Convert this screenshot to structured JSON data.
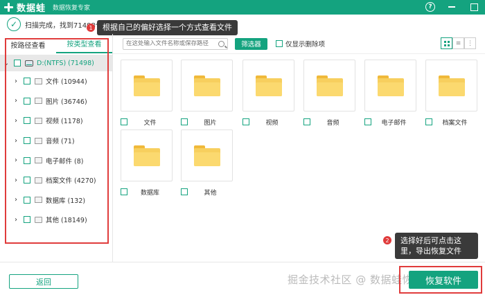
{
  "titlebar": {
    "app_name": "数据蛙",
    "app_subtitle": "数据恢复专家",
    "help_label": "?"
  },
  "scan": {
    "status_text": "扫描完成，找到71498个",
    "check_label": "✓"
  },
  "tooltips": {
    "tip1": "根据自己的偏好选择一个方式查看文件",
    "tip1_badge": "1",
    "tip2": "选择好后可点击这里，导出恢复文件",
    "tip2_badge": "2"
  },
  "left_panel": {
    "tabs": [
      {
        "label": "按路径查看"
      },
      {
        "label": "按类型查看"
      }
    ],
    "root": {
      "label": "D:(NTFS) (71498)"
    },
    "items": [
      {
        "label": "文件 (10944)"
      },
      {
        "label": "图片 (36746)"
      },
      {
        "label": "视频 (1178)"
      },
      {
        "label": "音频 (71)"
      },
      {
        "label": "电子邮件 (8)"
      },
      {
        "label": "档案文件 (4270)"
      },
      {
        "label": "数据库 (132)"
      },
      {
        "label": "其他 (18149)"
      }
    ]
  },
  "toolbar": {
    "search_placeholder": "在这处输入文件名称或保存路径",
    "filter_label": "筛选器",
    "only_deleted_label": "仅显示删除项"
  },
  "grid": {
    "tiles": [
      {
        "label": "文件"
      },
      {
        "label": "图片"
      },
      {
        "label": "视频"
      },
      {
        "label": "音频"
      },
      {
        "label": "电子邮件"
      },
      {
        "label": "档案文件"
      },
      {
        "label": "数据库"
      },
      {
        "label": "其他"
      }
    ]
  },
  "footer": {
    "back_label": "返回",
    "export_label": "恢复软件",
    "watermark": "掘金技术社区 @ 数据蛙恢复软件"
  },
  "colors": {
    "accent": "#14a37f",
    "annotation": "#e03b3b",
    "folder": "#f7cf5e"
  }
}
